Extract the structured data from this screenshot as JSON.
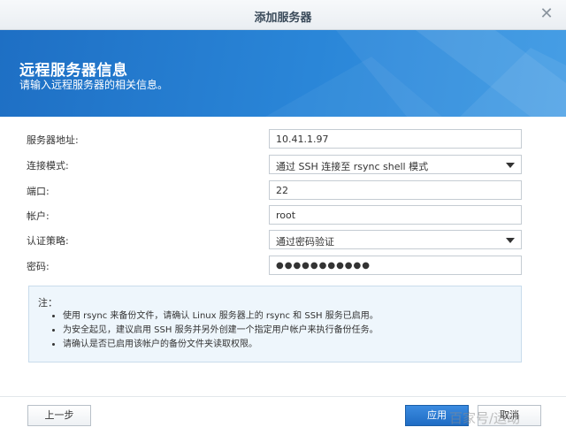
{
  "dialog": {
    "title": "添加服务器"
  },
  "banner": {
    "heading": "远程服务器信息",
    "subheading": "请输入远程服务器的相关信息。"
  },
  "form": {
    "server_address": {
      "label": "服务器地址:",
      "value": "10.41.1.97"
    },
    "connection_mode": {
      "label": "连接模式:",
      "value": "通过 SSH 连接至 rsync shell 模式"
    },
    "port": {
      "label": "端口:",
      "value": "22"
    },
    "account": {
      "label": "帐户:",
      "value": "root"
    },
    "auth_policy": {
      "label": "认证策略:",
      "value": "通过密码验证"
    },
    "password": {
      "label": "密码:",
      "value": "●●●●●●●●●●●"
    }
  },
  "note": {
    "title": "注：",
    "items": [
      "使用 rsync 来备份文件，请确认 Linux 服务器上的 rsync 和 SSH 服务已启用。",
      "为安全起见，建议启用 SSH 服务并另外创建一个指定用户帐户来执行备份任务。",
      "请确认是否已启用该帐户的备份文件夹读取权限。"
    ]
  },
  "buttons": {
    "prev": "上一步",
    "apply": "应用",
    "cancel": "取消"
  },
  "watermark": "百家号/运动",
  "colors": {
    "banner": "#2a86d8",
    "primary_button": "#1f6cc4",
    "note_background": "#eef6fc"
  }
}
